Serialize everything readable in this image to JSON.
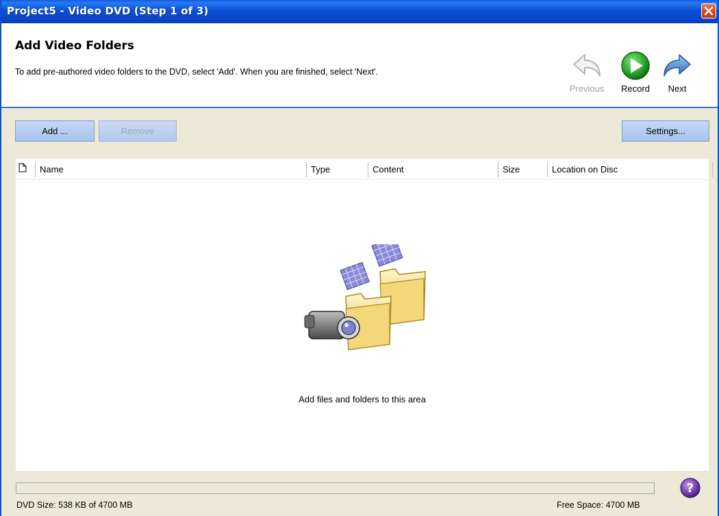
{
  "window": {
    "title": "Project5 - Video DVD (Step 1 of 3)"
  },
  "header": {
    "title": "Add Video Folders",
    "description": "To add pre-authored video folders to the DVD, select 'Add'.  When you are finished, select 'Next'.",
    "nav": {
      "previous": "Previous",
      "record": "Record",
      "next": "Next"
    }
  },
  "toolbar": {
    "add": "Add ...",
    "remove": "Remove",
    "settings": "Settings..."
  },
  "list": {
    "columns": [
      "Name",
      "Type",
      "Content",
      "Size",
      "Location on Disc"
    ],
    "empty_message": "Add files and folders to this area"
  },
  "status": {
    "dvd_size": "DVD Size: 538 KB of 4700 MB",
    "free_space": "Free Space: 4700 MB",
    "progress_fraction": 0.0
  },
  "colors": {
    "titlebar": "#0a4fd6",
    "record": "#2fae2f",
    "next": "#4a8fd6",
    "button": "#b3cbf0"
  }
}
